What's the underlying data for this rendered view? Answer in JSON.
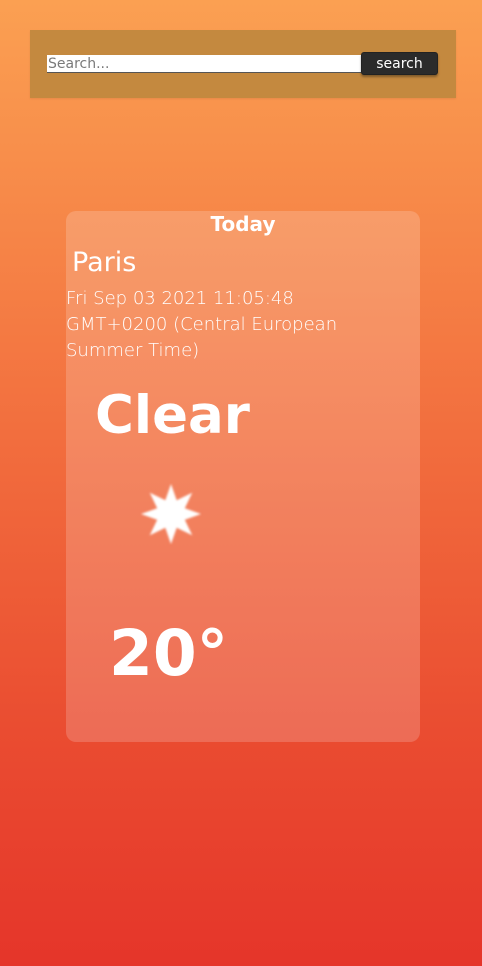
{
  "search": {
    "placeholder": "Search...",
    "button_label": "search"
  },
  "card": {
    "heading": "Today",
    "city": "Paris",
    "datetime": "Fri Sep 03 2021 11:05:48 GMT+0200 (Central European Summer Time)",
    "condition": "Clear",
    "condition_icon": "sun-icon",
    "temperature": "20°"
  },
  "colors": {
    "background_top": "#fba052",
    "background_bottom": "#e5352a",
    "search_bar": "#c4893f",
    "button": "#2b2b2b",
    "text": "#ffffff"
  }
}
